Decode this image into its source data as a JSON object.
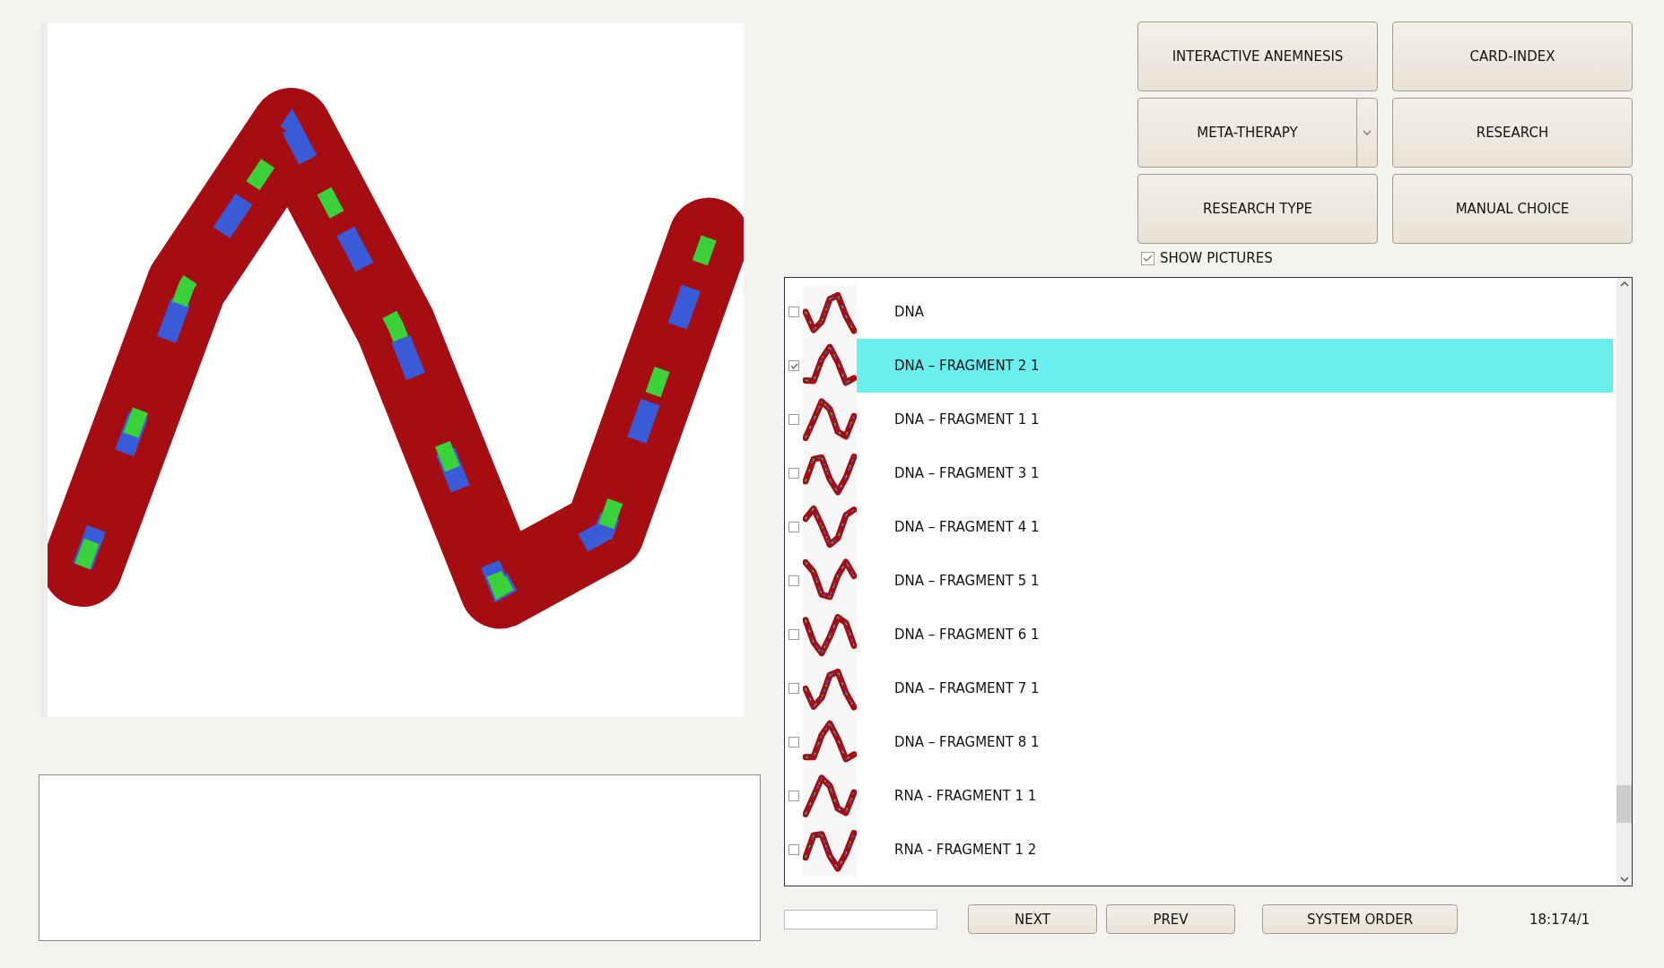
{
  "buttons": [
    {
      "label": "INTERACTIVE ANEMNESIS",
      "kind": "plain"
    },
    {
      "label": "CARD-INDEX",
      "kind": "plain"
    },
    {
      "label": "META-THERAPY",
      "kind": "split"
    },
    {
      "label": "RESEARCH",
      "kind": "plain"
    },
    {
      "label": "RESEARCH TYPE",
      "kind": "plain"
    },
    {
      "label": "MANUAL CHOICE",
      "kind": "plain"
    }
  ],
  "show_pictures": {
    "label": "SHOW PICTURES",
    "checked": true
  },
  "items": [
    {
      "label": "DNA",
      "checked": false,
      "selected": false
    },
    {
      "label": "DNA – FRAGMENT 2 1",
      "checked": true,
      "selected": true
    },
    {
      "label": "DNA – FRAGMENT 1 1",
      "checked": false,
      "selected": false
    },
    {
      "label": "DNA – FRAGMENT 3 1",
      "checked": false,
      "selected": false
    },
    {
      "label": "DNA – FRAGMENT 4 1",
      "checked": false,
      "selected": false
    },
    {
      "label": "DNA – FRAGMENT 5 1",
      "checked": false,
      "selected": false
    },
    {
      "label": "DNA – FRAGMENT 6 1",
      "checked": false,
      "selected": false
    },
    {
      "label": "DNA – FRAGMENT 7 1",
      "checked": false,
      "selected": false
    },
    {
      "label": "DNA – FRAGMENT 8 1",
      "checked": false,
      "selected": false
    },
    {
      "label": "RNA - FRAGMENT 1 1",
      "checked": false,
      "selected": false
    },
    {
      "label": "RNA - FRAGMENT 1 2",
      "checked": false,
      "selected": false
    }
  ],
  "nav": [
    {
      "label": "NEXT"
    },
    {
      "label": "PREV"
    },
    {
      "label": "SYSTEM ORDER"
    }
  ],
  "status": "18:174/1"
}
